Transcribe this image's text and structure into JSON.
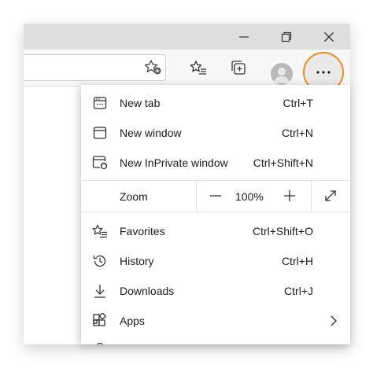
{
  "window_controls": {
    "minimize": "minimize-icon",
    "maximize": "restore-icon",
    "close": "close-icon"
  },
  "toolbar": {
    "icons": [
      "add-favorite-icon",
      "favorites-icon",
      "collections-icon",
      "profile-avatar",
      "more-options-icon"
    ],
    "highlight_color": "#f08b1d"
  },
  "menu": {
    "items_top": [
      {
        "label": "New tab",
        "shortcut": "Ctrl+T",
        "icon": "new-tab-icon"
      },
      {
        "label": "New window",
        "shortcut": "Ctrl+N",
        "icon": "new-window-icon"
      },
      {
        "label": "New InPrivate window",
        "shortcut": "Ctrl+Shift+N",
        "icon": "inprivate-icon"
      }
    ],
    "zoom": {
      "label": "Zoom",
      "value": "100%"
    },
    "items_bottom": [
      {
        "label": "Favorites",
        "shortcut": "Ctrl+Shift+O",
        "icon": "favorites-icon"
      },
      {
        "label": "History",
        "shortcut": "Ctrl+H",
        "icon": "history-icon"
      },
      {
        "label": "Downloads",
        "shortcut": "Ctrl+J",
        "icon": "download-icon"
      },
      {
        "label": "Apps",
        "shortcut": "",
        "icon": "apps-icon"
      }
    ]
  }
}
